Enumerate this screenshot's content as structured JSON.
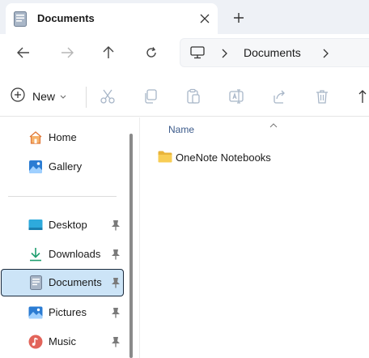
{
  "tab": {
    "title": "Documents",
    "icon": "documents-icon"
  },
  "nav": {
    "back": "back-arrow-icon",
    "forward": "forward-arrow-icon",
    "up": "up-arrow-icon",
    "refresh": "refresh-icon"
  },
  "address": {
    "location": "Documents",
    "root_icon": "this-pc-icon"
  },
  "toolbar": {
    "new_label": "New",
    "commands": [
      "cut",
      "copy",
      "paste",
      "rename",
      "share",
      "delete",
      "sort"
    ]
  },
  "sidebar": {
    "quick": [
      {
        "label": "Home",
        "icon": "home-icon"
      },
      {
        "label": "Gallery",
        "icon": "gallery-icon"
      }
    ],
    "pinned": [
      {
        "label": "Desktop",
        "icon": "desktop-icon",
        "pinned": true
      },
      {
        "label": "Downloads",
        "icon": "downloads-icon",
        "pinned": true
      },
      {
        "label": "Documents",
        "icon": "documents-icon",
        "pinned": true,
        "selected": true
      },
      {
        "label": "Pictures",
        "icon": "pictures-icon",
        "pinned": true
      },
      {
        "label": "Music",
        "icon": "music-icon",
        "pinned": true
      }
    ]
  },
  "content": {
    "columns": [
      "Name"
    ],
    "items": [
      {
        "name": "OneNote Notebooks",
        "type": "folder"
      }
    ]
  },
  "colors": {
    "selection": "#cce4f7",
    "folder": "#f5c748",
    "accent": "#0067c0"
  }
}
